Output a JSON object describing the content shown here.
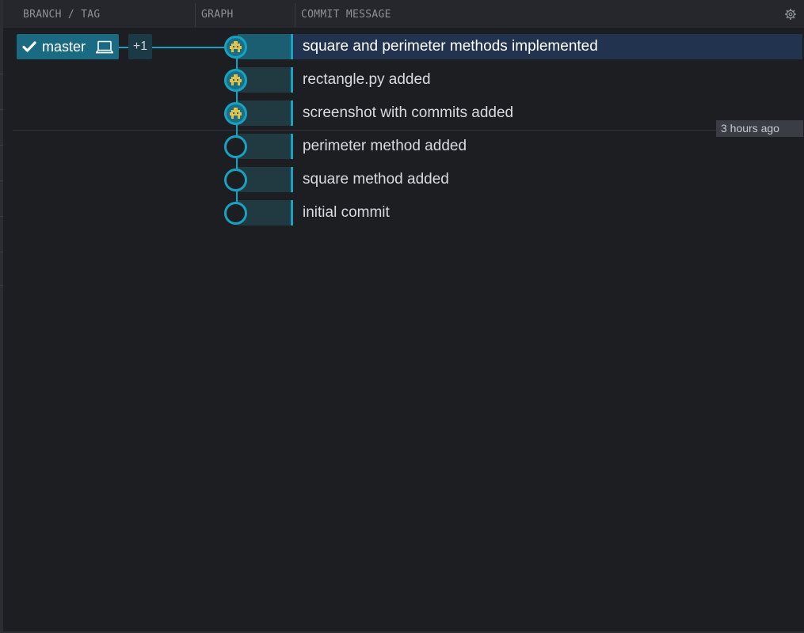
{
  "header": {
    "branch_tag": "BRANCH / TAG",
    "graph": "GRAPH",
    "commit_message": "COMMIT MESSAGE",
    "settings_icon": "gear-icon"
  },
  "branch": {
    "name": "master",
    "check_icon": "check-icon",
    "local_icon": "laptop-icon",
    "more_count": "+1"
  },
  "time_marker": "3 hours ago",
  "commits": [
    {
      "message": "square and perimeter methods implemented",
      "avatar": true,
      "selected": true
    },
    {
      "message": "rectangle.py added",
      "avatar": true,
      "selected": false
    },
    {
      "message": "screenshot with commits added",
      "avatar": true,
      "selected": false
    },
    {
      "message": "perimeter method added",
      "avatar": false,
      "selected": false
    },
    {
      "message": "square method added",
      "avatar": false,
      "selected": false
    },
    {
      "message": "initial commit",
      "avatar": false,
      "selected": false
    }
  ],
  "colors": {
    "accent": "#18a2c2",
    "branch_bg": "#1a6a82",
    "selected_row": "#223350",
    "background": "#1d1e22",
    "avatar_color": "#e6c14a"
  }
}
